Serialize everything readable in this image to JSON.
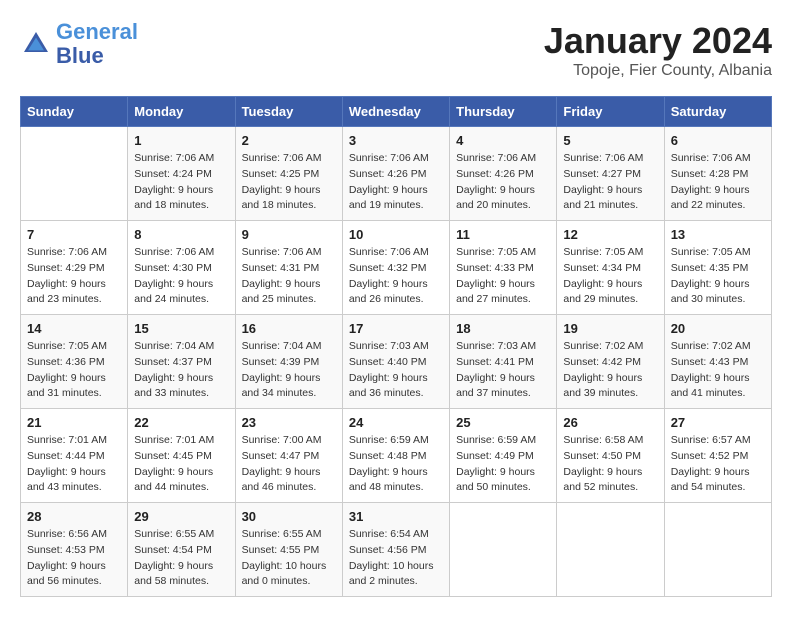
{
  "header": {
    "logo_line1": "General",
    "logo_line2": "Blue",
    "title": "January 2024",
    "subtitle": "Topoje, Fier County, Albania"
  },
  "days_of_week": [
    "Sunday",
    "Monday",
    "Tuesday",
    "Wednesday",
    "Thursday",
    "Friday",
    "Saturday"
  ],
  "weeks": [
    [
      {
        "day": "",
        "sunrise": "",
        "sunset": "",
        "daylight": ""
      },
      {
        "day": "1",
        "sunrise": "7:06 AM",
        "sunset": "4:24 PM",
        "daylight": "9 hours and 18 minutes."
      },
      {
        "day": "2",
        "sunrise": "7:06 AM",
        "sunset": "4:25 PM",
        "daylight": "9 hours and 18 minutes."
      },
      {
        "day": "3",
        "sunrise": "7:06 AM",
        "sunset": "4:26 PM",
        "daylight": "9 hours and 19 minutes."
      },
      {
        "day": "4",
        "sunrise": "7:06 AM",
        "sunset": "4:26 PM",
        "daylight": "9 hours and 20 minutes."
      },
      {
        "day": "5",
        "sunrise": "7:06 AM",
        "sunset": "4:27 PM",
        "daylight": "9 hours and 21 minutes."
      },
      {
        "day": "6",
        "sunrise": "7:06 AM",
        "sunset": "4:28 PM",
        "daylight": "9 hours and 22 minutes."
      }
    ],
    [
      {
        "day": "7",
        "sunrise": "7:06 AM",
        "sunset": "4:29 PM",
        "daylight": "9 hours and 23 minutes."
      },
      {
        "day": "8",
        "sunrise": "7:06 AM",
        "sunset": "4:30 PM",
        "daylight": "9 hours and 24 minutes."
      },
      {
        "day": "9",
        "sunrise": "7:06 AM",
        "sunset": "4:31 PM",
        "daylight": "9 hours and 25 minutes."
      },
      {
        "day": "10",
        "sunrise": "7:06 AM",
        "sunset": "4:32 PM",
        "daylight": "9 hours and 26 minutes."
      },
      {
        "day": "11",
        "sunrise": "7:05 AM",
        "sunset": "4:33 PM",
        "daylight": "9 hours and 27 minutes."
      },
      {
        "day": "12",
        "sunrise": "7:05 AM",
        "sunset": "4:34 PM",
        "daylight": "9 hours and 29 minutes."
      },
      {
        "day": "13",
        "sunrise": "7:05 AM",
        "sunset": "4:35 PM",
        "daylight": "9 hours and 30 minutes."
      }
    ],
    [
      {
        "day": "14",
        "sunrise": "7:05 AM",
        "sunset": "4:36 PM",
        "daylight": "9 hours and 31 minutes."
      },
      {
        "day": "15",
        "sunrise": "7:04 AM",
        "sunset": "4:37 PM",
        "daylight": "9 hours and 33 minutes."
      },
      {
        "day": "16",
        "sunrise": "7:04 AM",
        "sunset": "4:39 PM",
        "daylight": "9 hours and 34 minutes."
      },
      {
        "day": "17",
        "sunrise": "7:03 AM",
        "sunset": "4:40 PM",
        "daylight": "9 hours and 36 minutes."
      },
      {
        "day": "18",
        "sunrise": "7:03 AM",
        "sunset": "4:41 PM",
        "daylight": "9 hours and 37 minutes."
      },
      {
        "day": "19",
        "sunrise": "7:02 AM",
        "sunset": "4:42 PM",
        "daylight": "9 hours and 39 minutes."
      },
      {
        "day": "20",
        "sunrise": "7:02 AM",
        "sunset": "4:43 PM",
        "daylight": "9 hours and 41 minutes."
      }
    ],
    [
      {
        "day": "21",
        "sunrise": "7:01 AM",
        "sunset": "4:44 PM",
        "daylight": "9 hours and 43 minutes."
      },
      {
        "day": "22",
        "sunrise": "7:01 AM",
        "sunset": "4:45 PM",
        "daylight": "9 hours and 44 minutes."
      },
      {
        "day": "23",
        "sunrise": "7:00 AM",
        "sunset": "4:47 PM",
        "daylight": "9 hours and 46 minutes."
      },
      {
        "day": "24",
        "sunrise": "6:59 AM",
        "sunset": "4:48 PM",
        "daylight": "9 hours and 48 minutes."
      },
      {
        "day": "25",
        "sunrise": "6:59 AM",
        "sunset": "4:49 PM",
        "daylight": "9 hours and 50 minutes."
      },
      {
        "day": "26",
        "sunrise": "6:58 AM",
        "sunset": "4:50 PM",
        "daylight": "9 hours and 52 minutes."
      },
      {
        "day": "27",
        "sunrise": "6:57 AM",
        "sunset": "4:52 PM",
        "daylight": "9 hours and 54 minutes."
      }
    ],
    [
      {
        "day": "28",
        "sunrise": "6:56 AM",
        "sunset": "4:53 PM",
        "daylight": "9 hours and 56 minutes."
      },
      {
        "day": "29",
        "sunrise": "6:55 AM",
        "sunset": "4:54 PM",
        "daylight": "9 hours and 58 minutes."
      },
      {
        "day": "30",
        "sunrise": "6:55 AM",
        "sunset": "4:55 PM",
        "daylight": "10 hours and 0 minutes."
      },
      {
        "day": "31",
        "sunrise": "6:54 AM",
        "sunset": "4:56 PM",
        "daylight": "10 hours and 2 minutes."
      },
      {
        "day": "",
        "sunrise": "",
        "sunset": "",
        "daylight": ""
      },
      {
        "day": "",
        "sunrise": "",
        "sunset": "",
        "daylight": ""
      },
      {
        "day": "",
        "sunrise": "",
        "sunset": "",
        "daylight": ""
      }
    ]
  ]
}
